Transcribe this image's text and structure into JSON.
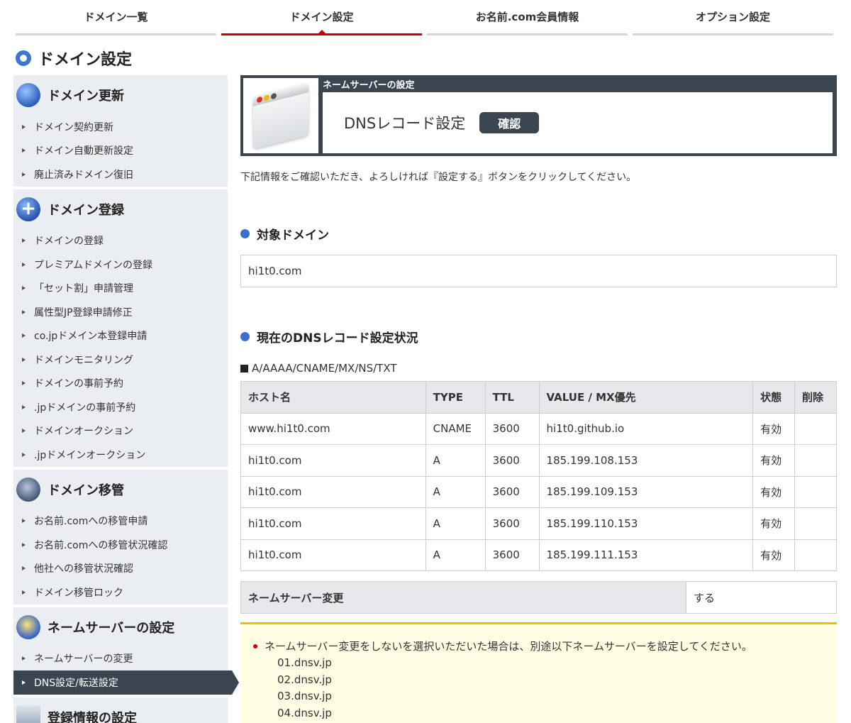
{
  "tabs": [
    "ドメイン一覧",
    "ドメイン設定",
    "お名前.com会員情報",
    "オプション設定"
  ],
  "page_title": "ドメイン設定",
  "sidebar": {
    "sections": [
      {
        "title": "ドメイン更新",
        "icon": "renew-icon",
        "items": [
          "ドメイン契約更新",
          "ドメイン自動更新設定",
          "廃止済みドメイン復旧"
        ]
      },
      {
        "title": "ドメイン登録",
        "icon": "add-icon",
        "items": [
          "ドメインの登録",
          "プレミアムドメインの登録",
          "「セット割」申請管理",
          "属性型JP登録申請修正",
          "co.jpドメイン本登録申請",
          "ドメインモニタリング",
          "ドメインの事前予約",
          ".jpドメインの事前予約",
          "ドメインオークション",
          ".jpドメインオークション"
        ]
      },
      {
        "title": "ドメイン移管",
        "icon": "transfer-icon",
        "items": [
          "お名前.comへの移管申請",
          "お名前.comへの移管状況確認",
          "他社への移管状況確認",
          "ドメイン移管ロック"
        ]
      },
      {
        "title": "ネームサーバーの設定",
        "icon": "nameserver-icon",
        "items": [
          "ネームサーバーの変更",
          "DNS設定/転送設定"
        ]
      },
      {
        "title": "登録情報の設定",
        "icon": "registration-icon",
        "items": []
      }
    ]
  },
  "header": {
    "label": "ネームサーバーの設定",
    "title": "DNSレコード設定",
    "badge": "確認"
  },
  "intro": "下記情報をご確認いただき、よろしければ『設定する』ボタンをクリックしてください。",
  "target_domain": {
    "title": "対象ドメイン",
    "value": "hi1t0.com"
  },
  "dns_status": {
    "title": "現在のDNSレコード設定状況",
    "record_types": "A/AAAA/CNAME/MX/NS/TXT",
    "columns": [
      "ホスト名",
      "TYPE",
      "TTL",
      "VALUE / MX優先",
      "状態",
      "削除"
    ],
    "rows": [
      [
        "www.hi1t0.com",
        "CNAME",
        "3600",
        "hi1t0.github.io",
        "有効",
        ""
      ],
      [
        "hi1t0.com",
        "A",
        "3600",
        "185.199.108.153",
        "有効",
        ""
      ],
      [
        "hi1t0.com",
        "A",
        "3600",
        "185.199.109.153",
        "有効",
        ""
      ],
      [
        "hi1t0.com",
        "A",
        "3600",
        "185.199.110.153",
        "有効",
        ""
      ],
      [
        "hi1t0.com",
        "A",
        "3600",
        "185.199.111.153",
        "有効",
        ""
      ]
    ]
  },
  "nameserver_change": {
    "label": "ネームサーバー変更",
    "value": "する"
  },
  "notice": {
    "text": "ネームサーバー変更をしないを選択いただいた場合は、別途以下ネームサーバーを設定してください。",
    "servers": [
      "01.dnsv.jp",
      "02.dnsv.jp",
      "03.dnsv.jp",
      "04.dnsv.jp"
    ]
  },
  "colors": {
    "active_tab": "#c7000b",
    "dark": "#3a4550",
    "accent_blue": "#3a6fd0",
    "notice_bg": "#fffde3",
    "notice_border": "#f0c000"
  }
}
